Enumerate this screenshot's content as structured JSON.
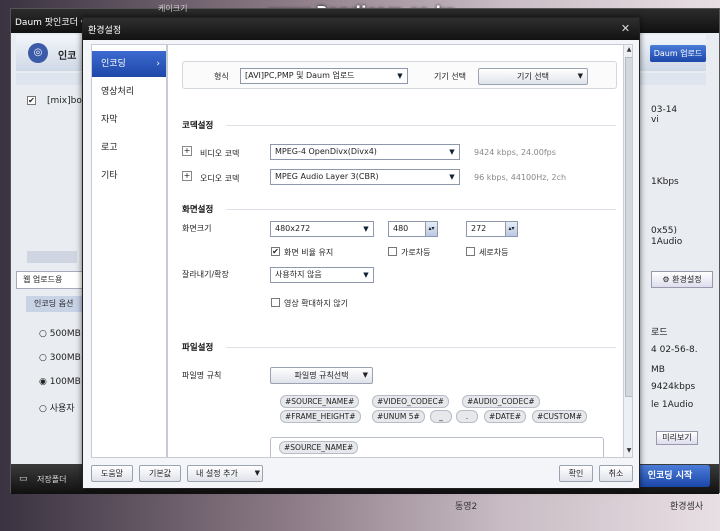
{
  "watermark": "www.Bandicam.co.kr",
  "background_app": {
    "title": "Daum 팟인코더 ▾",
    "header_label": "인코",
    "upload_button": "Daum 업로드",
    "file_item": "[mix]bo",
    "file_info": [
      "03-14",
      "vi",
      "1Kbps",
      "0x55)",
      "1Audio"
    ],
    "tab_label": "웹 업로드용",
    "options_label": "인코딩 옵션",
    "radio_options": [
      "500MB",
      "300MB",
      "100MB",
      "사용자"
    ],
    "right_info": [
      "로드",
      "4 02-56-8.",
      "MB",
      "9424kbps",
      "le 1Audio"
    ],
    "env_button": "환경설정",
    "preview_button": "미리보기",
    "save_folder": "저장폴더",
    "encode_button": "인코딩 시작",
    "desktop_labels": [
      "케이크기",
      "동영2",
      "환경셈사"
    ]
  },
  "dialog": {
    "title": "환경설정",
    "close": "✕",
    "sidebar": [
      {
        "label": "인코딩",
        "active": true
      },
      {
        "label": "영상처리"
      },
      {
        "label": "자막"
      },
      {
        "label": "로고"
      },
      {
        "label": "기타"
      }
    ],
    "format_label": "형식",
    "format_value": "[AVI]PC,PMP 및 Daum 업로드",
    "device_label": "기기 선택",
    "device_value": "기기 선택",
    "codec_section": "코덱설정",
    "video_codec_label": "비디오 코덱",
    "video_codec_value": "MPEG-4 OpenDivx(Divx4)",
    "video_codec_info": "9424 kbps, 24.00fps",
    "audio_codec_label": "오디오 코덱",
    "audio_codec_value": "MPEG Audio Layer 3(CBR)",
    "audio_codec_info": "96 kbps, 44100Hz, 2ch",
    "screen_section": "화면설정",
    "screen_size_label": "화면크기",
    "screen_size_value": "480x272",
    "width_value": "480",
    "height_value": "272",
    "keep_ratio_label": "화면 비율 유지",
    "keep_ratio_checked": true,
    "horizontal_flip_label": "가로차등",
    "vertical_flip_label": "세로차등",
    "crop_label": "잘라내기/확장",
    "crop_value": "사용하지 않음",
    "no_enlarge_label": "영상 확대하지 않기",
    "file_section": "파일설정",
    "filename_rule_label": "파일명 규칙",
    "filename_rule_button": "파일명 규칙선택",
    "tags_row1": [
      "#SOURCE_NAME#",
      "#VIDEO_CODEC#",
      "#AUDIO_CODEC#"
    ],
    "tags_row2": [
      "#FRAME_HEIGHT#",
      "#UNUM 5#",
      "_",
      ".",
      "#DATE#",
      "#CUSTOM#"
    ],
    "filename_value": "#SOURCE_NAME#",
    "help_button": "도움말",
    "default_button": "기본값",
    "my_settings_button": "내 설정 추가",
    "ok_button": "확인",
    "cancel_button": "취소"
  }
}
